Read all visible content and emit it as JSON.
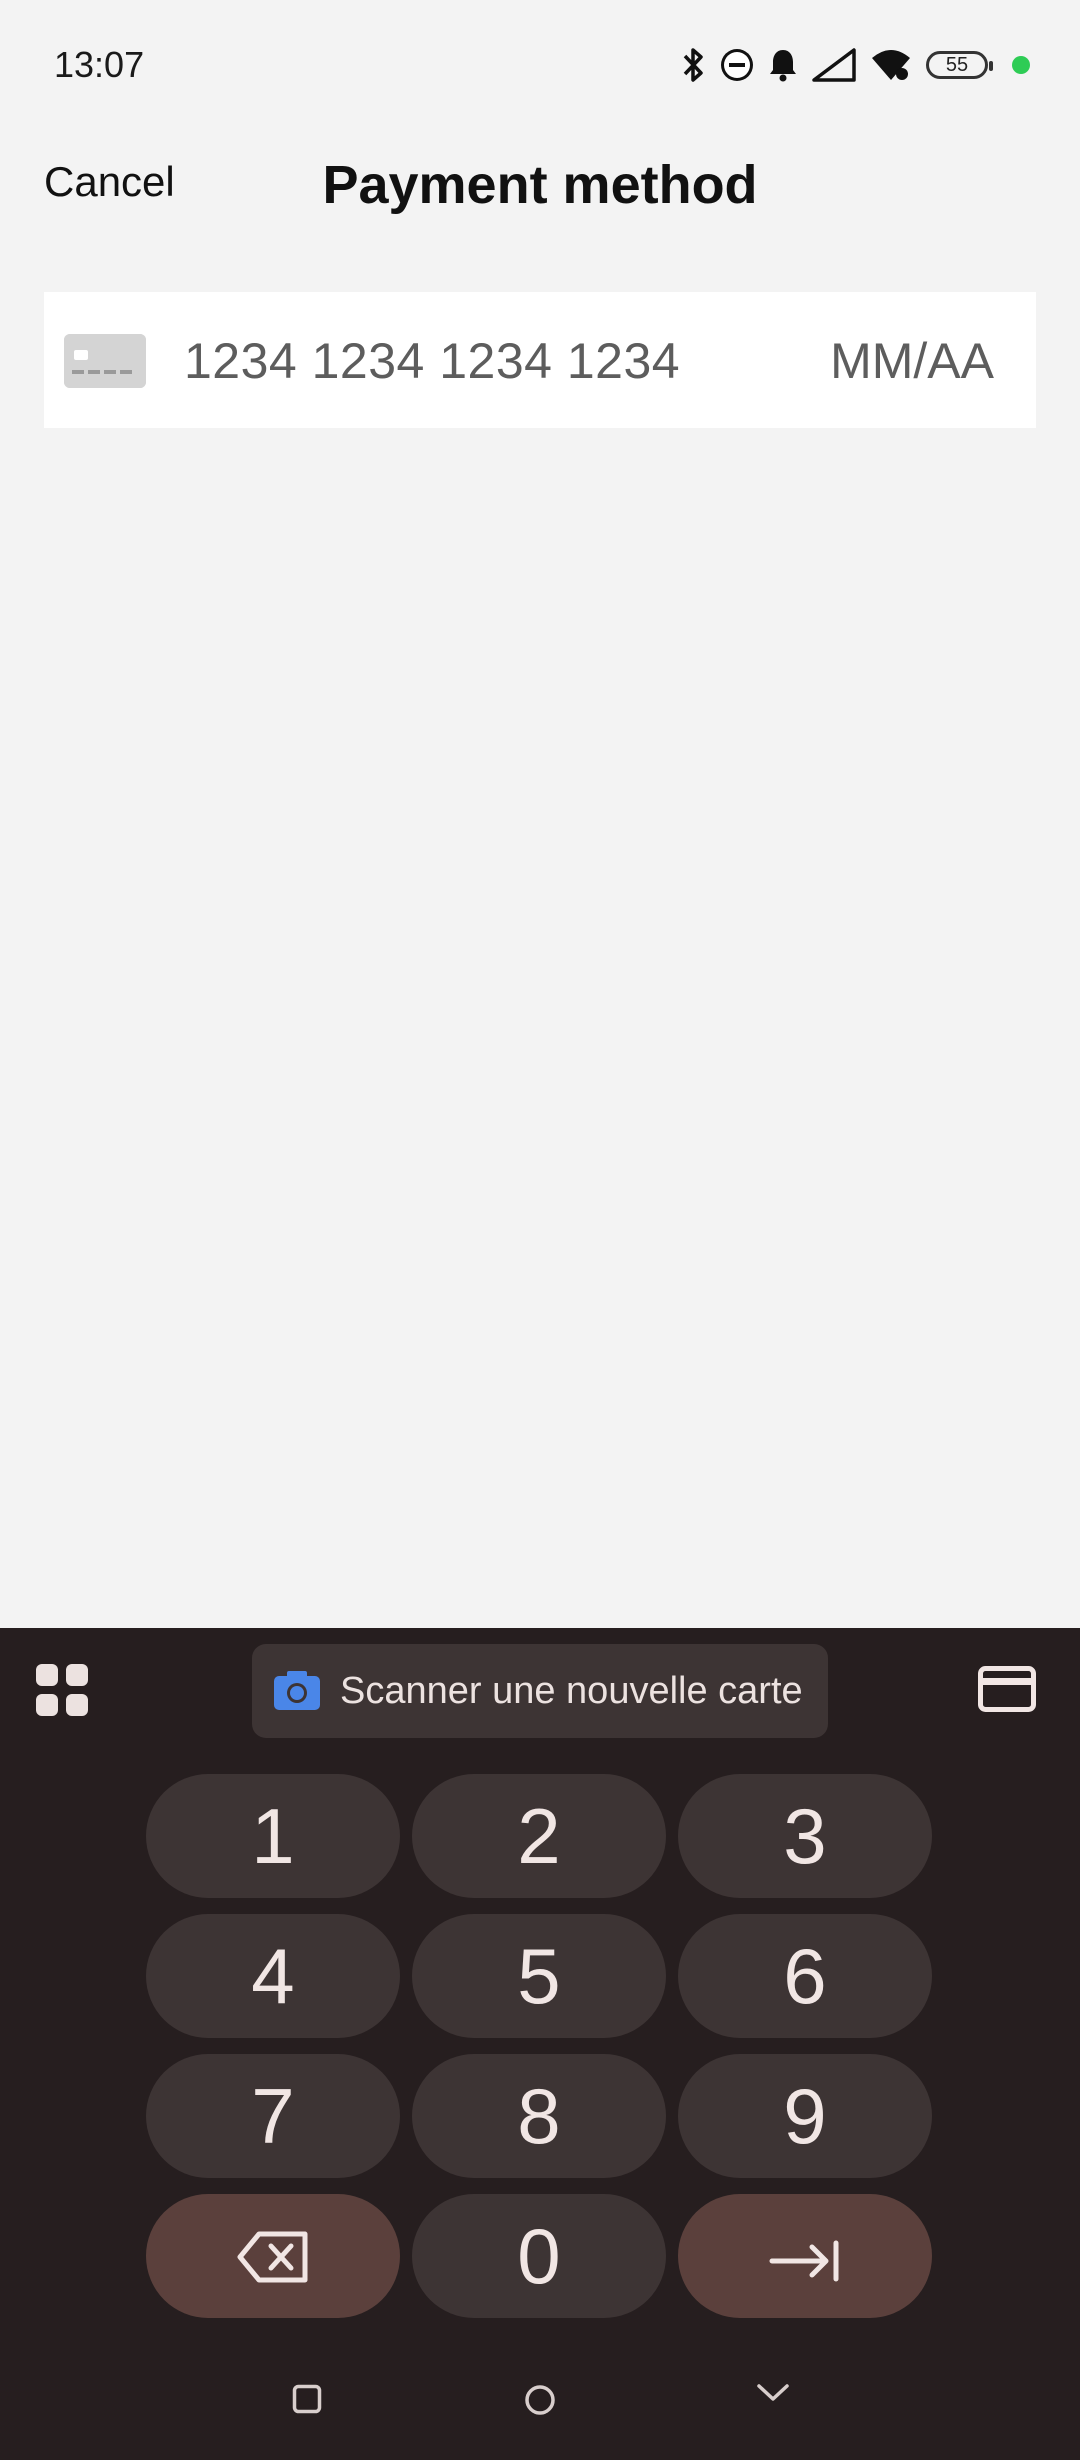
{
  "status_bar": {
    "time": "13:07",
    "battery": "55",
    "icons": [
      "bluetooth-icon",
      "do-not-disturb-icon",
      "bell-icon",
      "signal-icon",
      "wifi-icon",
      "battery-icon",
      "privacy-dot-icon"
    ],
    "privacy_dot_color": "#2ecc55"
  },
  "header": {
    "cancel_label": "Cancel",
    "title": "Payment method"
  },
  "card_field": {
    "icon": "credit-card-icon",
    "number_placeholder": "1234 1234 1234 1234",
    "expiry_placeholder": "MM/AA"
  },
  "keyboard": {
    "apps_icon": "apps-grid-icon",
    "scan_label": "Scanner une nouvelle carte",
    "scan_icon": "camera-icon",
    "card_icon": "credit-card-icon",
    "keys": {
      "k1": "1",
      "k2": "2",
      "k3": "3",
      "k4": "4",
      "k5": "5",
      "k6": "6",
      "k7": "7",
      "k8": "8",
      "k9": "9",
      "k0": "0"
    },
    "backspace_icon": "backspace-icon",
    "tab_icon": "tab-next-icon",
    "accent_color": "#3d3434",
    "special_key_color": "#5b403c"
  },
  "nav_bar": {
    "icons": [
      "recents-square-icon",
      "home-circle-icon",
      "hide-keyboard-chevron-icon"
    ]
  }
}
